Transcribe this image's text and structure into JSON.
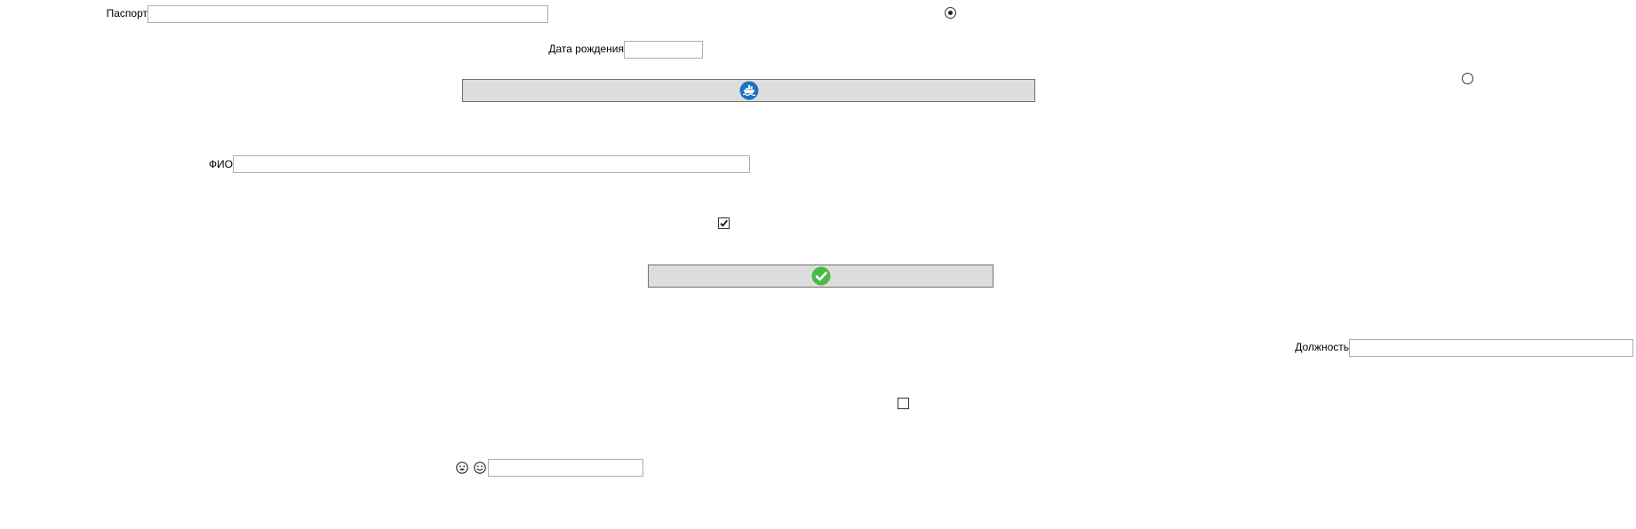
{
  "form": {
    "passport": {
      "label": "Паспорт",
      "value": ""
    },
    "birth_date": {
      "label": "Дата рождения",
      "value": ""
    },
    "full_name": {
      "label": "ФИО",
      "value": ""
    },
    "position": {
      "label": "Должность",
      "value": ""
    },
    "extra_field": {
      "value": ""
    }
  },
  "controls": {
    "radio_1": {
      "checked": true
    },
    "radio_2": {
      "checked": false
    },
    "checkbox_1": {
      "checked": true
    },
    "checkbox_2": {
      "checked": false
    }
  },
  "buttons": {
    "ship_button": {
      "icon": "cargo-ship-icon",
      "color": "#1e73be"
    },
    "confirm_button": {
      "icon": "checkmark-icon",
      "color": "#4cba47"
    }
  },
  "icons": {
    "emoji_1": "grinning-face-icon",
    "emoji_2": "smiling-face-icon"
  }
}
